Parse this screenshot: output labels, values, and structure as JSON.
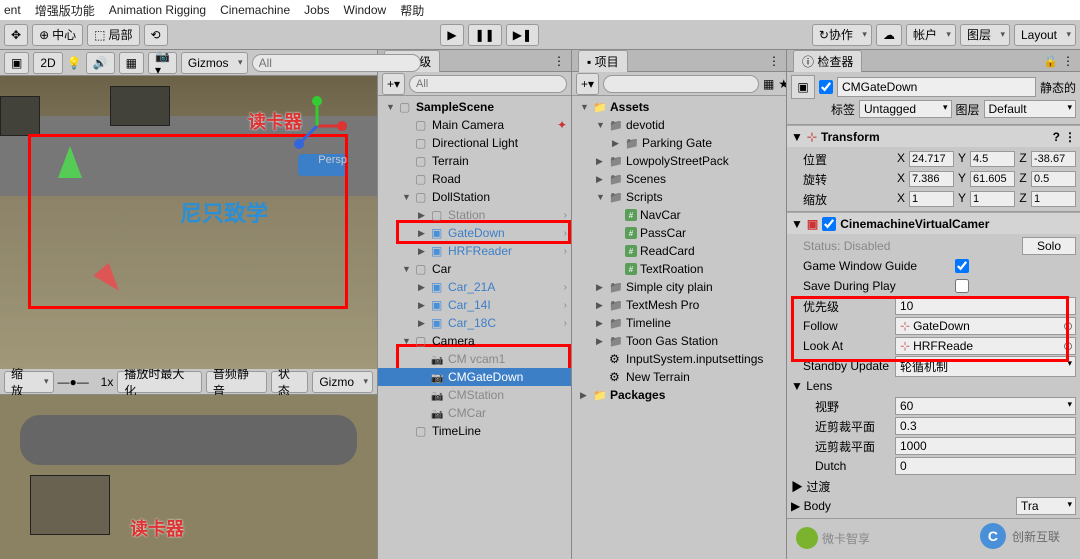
{
  "menu": [
    "ent",
    "增强版功能",
    "Animation Rigging",
    "Cinemachine",
    "Jobs",
    "Window",
    "帮助"
  ],
  "toolbar": {
    "center": "中心",
    "local": "局部",
    "collab": "协作",
    "account": "帐户",
    "layers": "图层",
    "layout": "Layout"
  },
  "scene": {
    "gizmos": "Gizmos",
    "search_ph": "All",
    "zoom": "缩放",
    "zoom_val": "1x",
    "playmax": "播放时最大化",
    "mute": "音频静音",
    "state": "状态",
    "gizmos2": "Gizmo",
    "reader_label": "读卡器",
    "overlay": "尼只致学",
    "persp": "Persp"
  },
  "hierarchy": {
    "title": "层级",
    "plus": "+",
    "search_ph": "All",
    "items": [
      {
        "t": "SampleScene",
        "d": 0,
        "bold": true,
        "exp": "▼",
        "ico": "cube"
      },
      {
        "t": "Main Camera",
        "d": 1,
        "ico": "cube",
        "star": true
      },
      {
        "t": "Directional Light",
        "d": 1,
        "ico": "cube"
      },
      {
        "t": "Terrain",
        "d": 1,
        "ico": "cube"
      },
      {
        "t": "Road",
        "d": 1,
        "ico": "cube"
      },
      {
        "t": "DollStation",
        "d": 1,
        "exp": "▼",
        "ico": "cube"
      },
      {
        "t": "Station",
        "d": 2,
        "exp": "▶",
        "ico": "cube",
        "chev": true,
        "dim": true
      },
      {
        "t": "GateDown",
        "d": 2,
        "exp": "▶",
        "ico": "prefab",
        "prefab": true,
        "chev": true
      },
      {
        "t": "HRFReader",
        "d": 2,
        "exp": "▶",
        "ico": "prefab",
        "prefab": true,
        "chev": true
      },
      {
        "t": "Car",
        "d": 1,
        "exp": "▼",
        "ico": "cube"
      },
      {
        "t": "Car_21A",
        "d": 2,
        "exp": "▶",
        "ico": "prefab",
        "prefab": true,
        "chev": true
      },
      {
        "t": "Car_14I",
        "d": 2,
        "exp": "▶",
        "ico": "prefab",
        "prefab": true,
        "chev": true
      },
      {
        "t": "Car_18C",
        "d": 2,
        "exp": "▶",
        "ico": "prefab",
        "prefab": true,
        "chev": true
      },
      {
        "t": "Camera",
        "d": 1,
        "exp": "▼",
        "ico": "cube"
      },
      {
        "t": "CM vcam1",
        "d": 2,
        "ico": "cam",
        "dim": true
      },
      {
        "t": "CMGateDown",
        "d": 2,
        "ico": "cam",
        "sel": true
      },
      {
        "t": "CMStation",
        "d": 2,
        "ico": "cam",
        "dim": true
      },
      {
        "t": "CMCar",
        "d": 2,
        "ico": "cam",
        "dim": true
      },
      {
        "t": "TimeLine",
        "d": 1,
        "ico": "cube"
      }
    ]
  },
  "project": {
    "title": "项目",
    "search_ph": "",
    "vis": "14",
    "items": [
      {
        "t": "Assets",
        "d": 0,
        "exp": "▼",
        "ico": "folder-lit",
        "bold": true
      },
      {
        "t": "devotid",
        "d": 1,
        "exp": "▼",
        "ico": "folder"
      },
      {
        "t": "Parking Gate",
        "d": 2,
        "exp": "▶",
        "ico": "folder"
      },
      {
        "t": "LowpolyStreetPack",
        "d": 1,
        "exp": "▶",
        "ico": "folder"
      },
      {
        "t": "Scenes",
        "d": 1,
        "exp": "▶",
        "ico": "folder"
      },
      {
        "t": "Scripts",
        "d": 1,
        "exp": "▼",
        "ico": "folder"
      },
      {
        "t": "NavCar",
        "d": 2,
        "ico": "cs"
      },
      {
        "t": "PassCar",
        "d": 2,
        "ico": "cs"
      },
      {
        "t": "ReadCard",
        "d": 2,
        "ico": "cs"
      },
      {
        "t": "TextRoation",
        "d": 2,
        "ico": "cs"
      },
      {
        "t": "Simple city plain",
        "d": 1,
        "exp": "▶",
        "ico": "folder"
      },
      {
        "t": "TextMesh Pro",
        "d": 1,
        "exp": "▶",
        "ico": "folder"
      },
      {
        "t": "Timeline",
        "d": 1,
        "exp": "▶",
        "ico": "folder"
      },
      {
        "t": "Toon Gas Station",
        "d": 1,
        "exp": "▶",
        "ico": "folder"
      },
      {
        "t": "InputSystem.inputsettings",
        "d": 1,
        "ico": "asset"
      },
      {
        "t": "New Terrain",
        "d": 1,
        "ico": "asset"
      },
      {
        "t": "Packages",
        "d": 0,
        "exp": "▶",
        "ico": "folder-lit",
        "bold": true
      }
    ]
  },
  "inspector": {
    "title": "检查器",
    "name": "CMGateDown",
    "static": "静态的",
    "tag_label": "标签",
    "tag": "Untagged",
    "layer_label": "图层",
    "layer": "Default",
    "transform": {
      "title": "Transform",
      "pos": "位置",
      "rot": "旋转",
      "scale": "缩放",
      "pos_x": "24.717",
      "pos_y": "4.5",
      "pos_z": "-38.67",
      "rot_x": "7.386",
      "rot_y": "61.605",
      "rot_z": "0.5",
      "scl_x": "1",
      "scl_y": "1",
      "scl_z": "1"
    },
    "vcam": {
      "title": "CinemachineVirtualCamer",
      "status_l": "Status:",
      "status": "Disabled",
      "solo": "Solo",
      "gwguides": "Game Window Guide",
      "gwguides_v": true,
      "saveplay": "Save During Play",
      "saveplay_v": false,
      "priority": "优先级",
      "priority_v": "10",
      "follow": "Follow",
      "follow_v": "GateDown",
      "lookat": "Look At",
      "lookat_v": "HRFReade",
      "standby": "Standby Update",
      "standby_v": "轮循机制",
      "lens": "Lens",
      "fov": "视野",
      "fov_v": "60",
      "near": "近剪裁平面",
      "near_v": "0.3",
      "far": "远剪裁平面",
      "far_v": "1000",
      "dutch": "Dutch",
      "dutch_v": "0",
      "trans": "过渡",
      "body": "Body",
      "body_v": "Tra"
    }
  },
  "watermark": {
    "brand": "创新互联",
    "wk": "微卡智享"
  }
}
